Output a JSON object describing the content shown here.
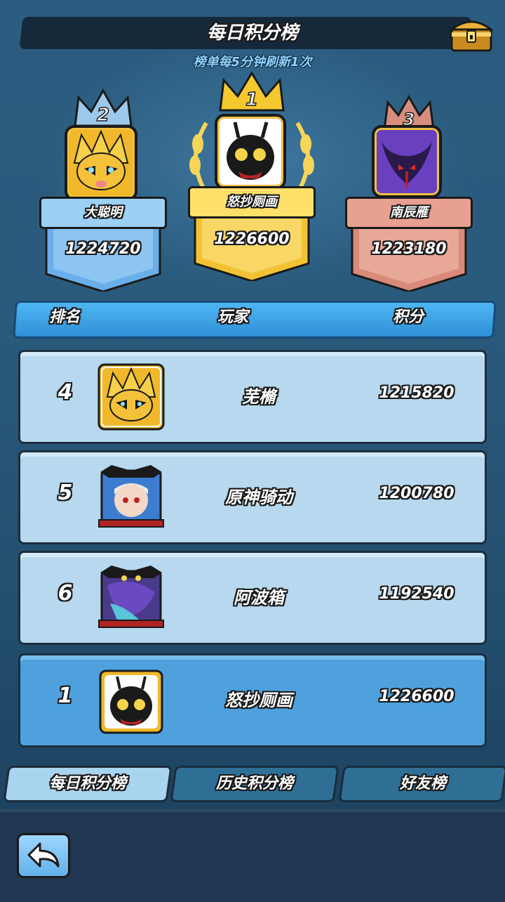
{
  "header": {
    "title": "每日积分榜",
    "subtitle": "榜单每5分钟刷新1次",
    "chest_icon": "treasure-chest-icon"
  },
  "podium": [
    {
      "rank": "1",
      "name": "怒抄厕画",
      "score": "1226600",
      "color": "#f2c233"
    },
    {
      "rank": "2",
      "name": "大聪明",
      "score": "1224720",
      "color": "#6aaeea"
    },
    {
      "rank": "3",
      "name": "南辰雁",
      "score": "1223180",
      "color": "#e09a8a"
    }
  ],
  "columns": {
    "rank": "排名",
    "player": "玩家",
    "score": "积分"
  },
  "rows": [
    {
      "rank": "4",
      "name": "芜樇",
      "score": "1215820",
      "avatar": "yellow-spiky-avatar"
    },
    {
      "rank": "5",
      "name": "原神骑动",
      "score": "1200780",
      "avatar": "white-hair-hero-avatar"
    },
    {
      "rank": "6",
      "name": "阿波箱",
      "score": "1192540",
      "avatar": "dark-dragon-avatar"
    }
  ],
  "my_row": {
    "rank": "1",
    "name": "怒抄厕画",
    "score": "1226600",
    "avatar": "black-creature-avatar"
  },
  "tabs": [
    {
      "label": "每日积分榜",
      "active": true
    },
    {
      "label": "历史积分榜",
      "active": false
    },
    {
      "label": "好友榜",
      "active": false
    }
  ],
  "back_icon": "back-arrow-icon"
}
